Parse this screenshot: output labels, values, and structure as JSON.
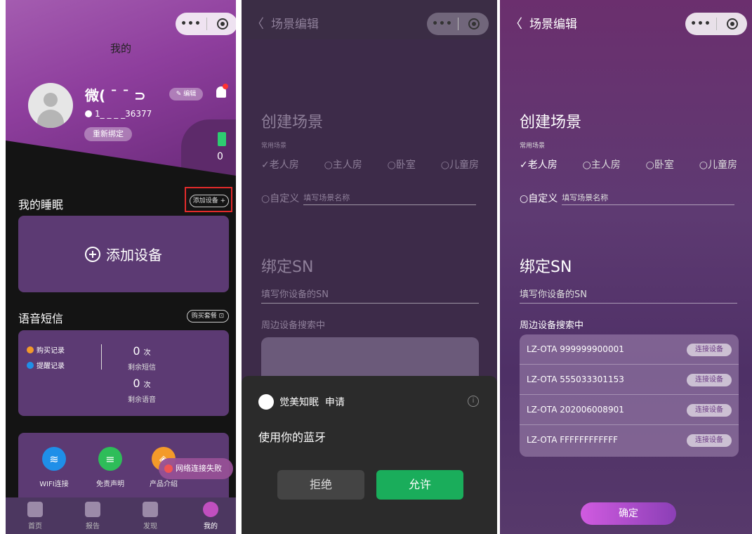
{
  "panel1": {
    "title": "我的",
    "nickname": "微( ¯ ¯ ⊃",
    "phone": "1_ _ _ _36377",
    "rebind": "重新绑定",
    "edit": "编辑",
    "battery_value": "0",
    "my_sleep": "我的睡眠",
    "add_device_chip": "添加设备 +",
    "add_device_card": "添加设备",
    "voice_sms": "语音短信",
    "buy_package": "购买套餐",
    "purchase_record": "购买记录",
    "reminder_record": "提醒记录",
    "sms_count": "0",
    "voice_count": "0",
    "times_unit": "次",
    "sms_remaining": "剩余短信",
    "voice_remaining": "剩余语音",
    "tools": [
      {
        "label": "WIFI连接",
        "color": "#1f8fe8"
      },
      {
        "label": "免责声明",
        "color": "#2ebd59"
      },
      {
        "label": "产品介绍",
        "color": "#f39a2a"
      }
    ],
    "toast": "网络连接失败",
    "tabs": [
      "首页",
      "报告",
      "发现",
      "我的"
    ]
  },
  "panel2": {
    "nav_title": "场景编辑",
    "create_scene": "创建场景",
    "common_scene": "常用场景",
    "options": [
      "✓老人房",
      "○主人房",
      "○卧室",
      "○儿童房"
    ],
    "custom_label": "○自定义",
    "custom_placeholder": "填写场景名称",
    "bind_sn": "绑定SN",
    "sn_placeholder": "填写你设备的SN",
    "searching": "周边设备搜索中",
    "sheet_app": "觉美知眠",
    "sheet_apply": "申请",
    "sheet_info": "i",
    "sheet_request": "使用你的蓝牙",
    "deny": "拒绝",
    "allow": "允许"
  },
  "panel3": {
    "nav_title": "场景编辑",
    "create_scene": "创建场景",
    "common_scene": "常用场景",
    "options": [
      "✓老人房",
      "○主人房",
      "○卧室",
      "○儿童房"
    ],
    "custom_label": "○自定义",
    "custom_placeholder": "填写场景名称",
    "bind_sn": "绑定SN",
    "sn_placeholder": "填写你设备的SN",
    "searching": "周边设备搜索中",
    "devices": [
      {
        "name": "LZ-OTA 999999900001",
        "action": "连接设备"
      },
      {
        "name": "LZ-OTA 555033301153",
        "action": "连接设备"
      },
      {
        "name": "LZ-OTA 202006008901",
        "action": "连接设备"
      },
      {
        "name": "LZ-OTA FFFFFFFFFFFF",
        "action": "连接设备"
      }
    ],
    "confirm": "确定"
  },
  "capsule": {
    "dots": "•••"
  },
  "nav_back": "〈"
}
